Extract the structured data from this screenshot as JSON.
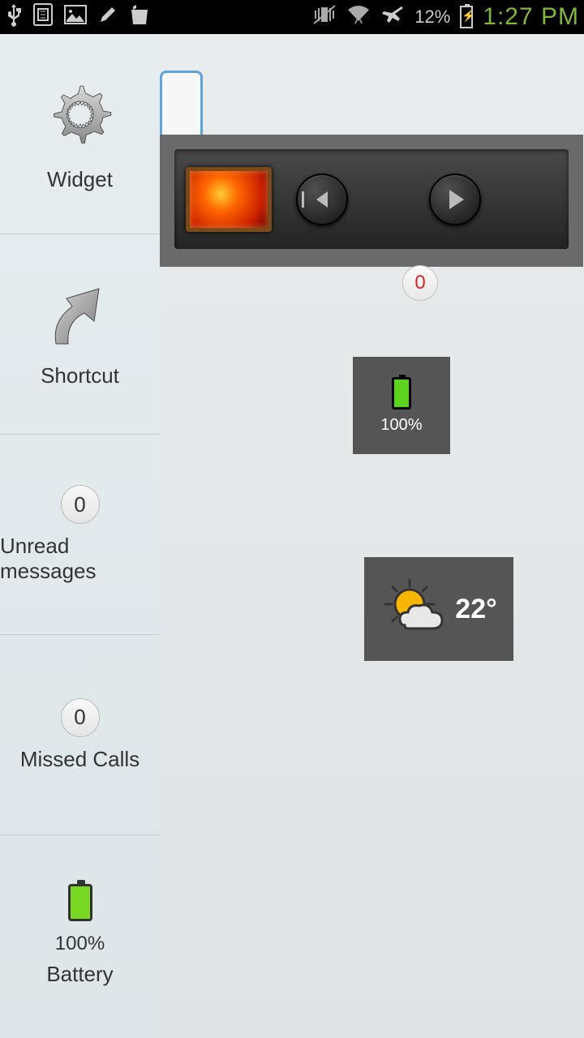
{
  "status": {
    "battery_pct": "12%",
    "time": "1:27 PM"
  },
  "sidebar": {
    "widget_label": "Widget",
    "shortcut_label": "Shortcut",
    "unread_count": "0",
    "unread_label": "Unread messages",
    "missed_count": "0",
    "missed_label": "Missed Calls",
    "battery_pct": "100%",
    "battery_label": "Battery"
  },
  "content": {
    "badge_count": "0",
    "battery_widget_pct": "100%",
    "weather_temp": "22°"
  }
}
